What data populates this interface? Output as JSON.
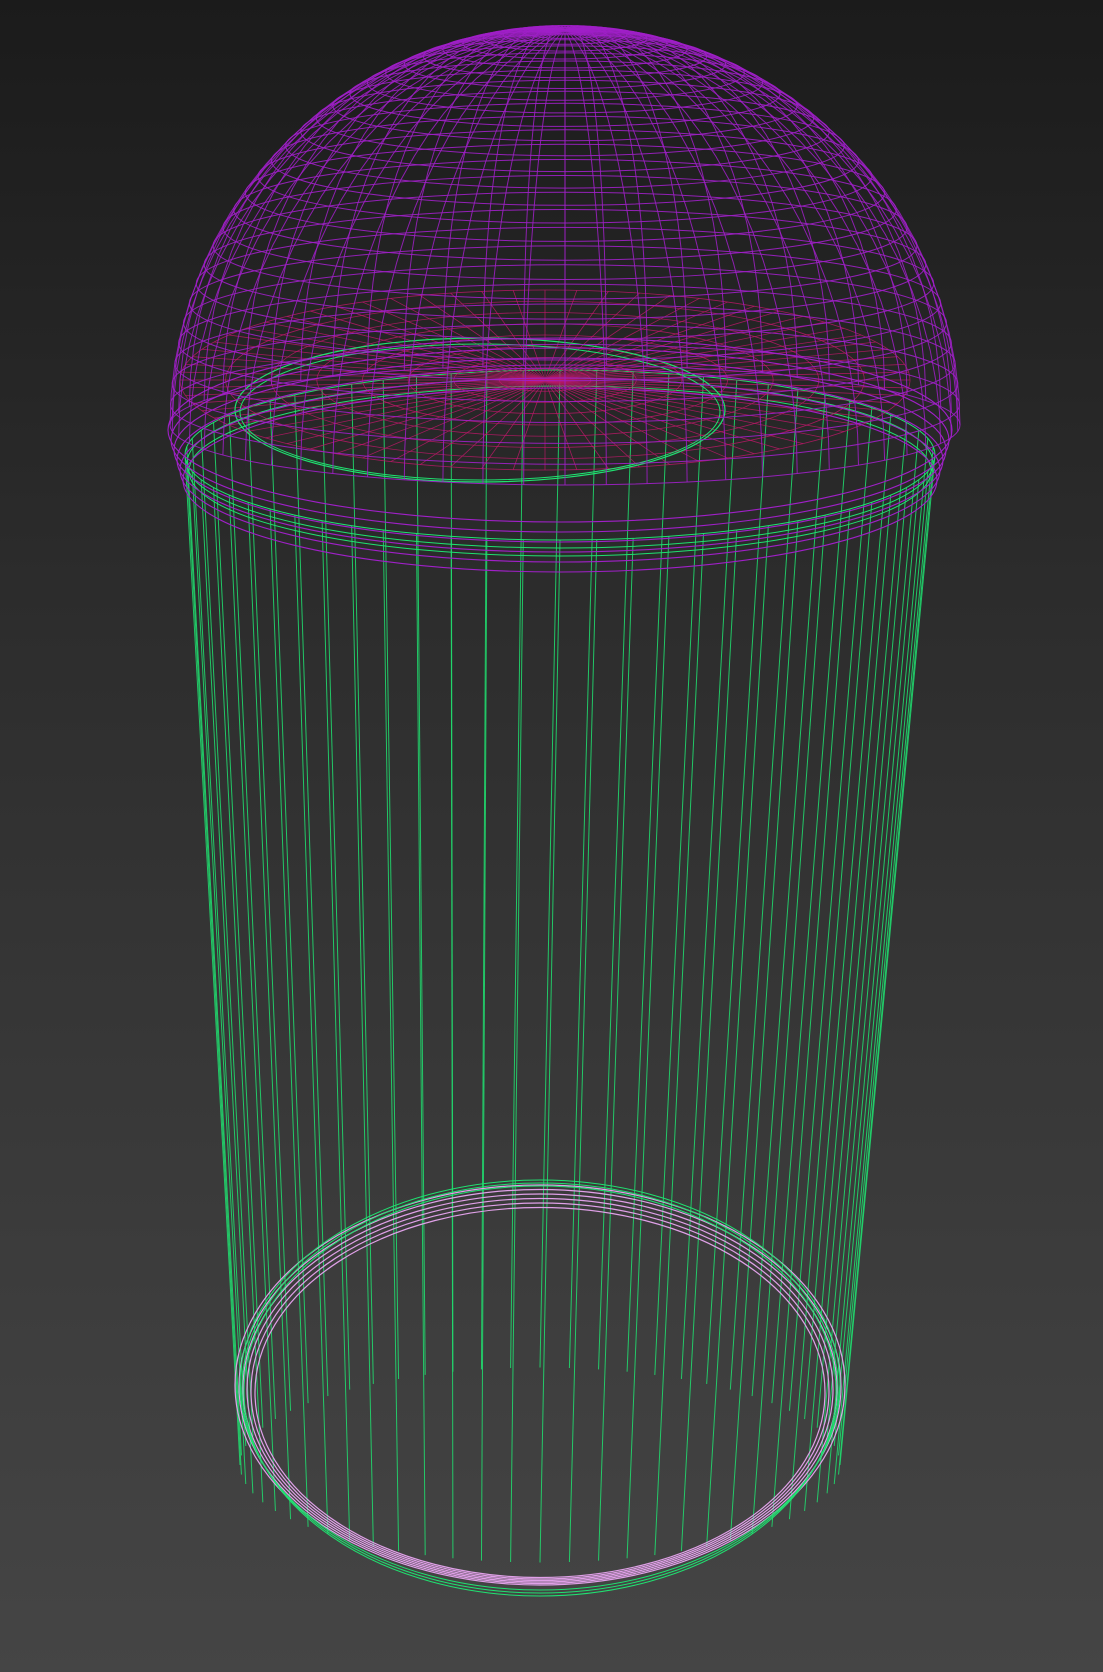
{
  "viewport": {
    "colors": {
      "background_top": "#1b1b1b",
      "background_bottom": "#454545",
      "dome_wire": "#a020c8",
      "dome_inner_wire": "#c0186a",
      "cylinder_wire": "#20e070",
      "base_ring_wire": "#e0a0e8"
    },
    "objects": [
      {
        "name": "dome",
        "shape": "hemisphere",
        "color": "dome_wire"
      },
      {
        "name": "cylinder",
        "shape": "cylinder",
        "color": "cylinder_wire"
      },
      {
        "name": "base-ring",
        "shape": "torus-ring",
        "color": "base_ring_wire"
      }
    ]
  }
}
